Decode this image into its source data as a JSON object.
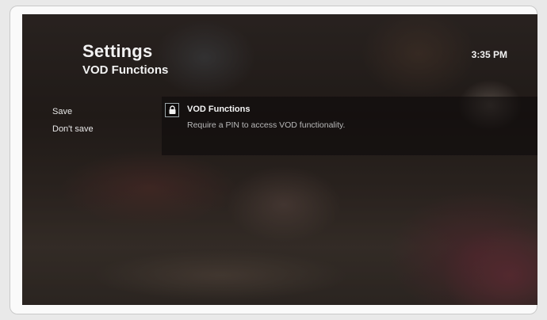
{
  "header": {
    "title": "Settings",
    "subtitle": "VOD Functions",
    "clock": "3:35 PM"
  },
  "menu": {
    "items": [
      {
        "label": "Save"
      },
      {
        "label": "Don't save"
      }
    ]
  },
  "panel": {
    "icon": "lock-icon",
    "title": "VOD Functions",
    "description": "Require a PIN to access VOD functionality."
  },
  "colors": {
    "text": "#f2f2f2",
    "muted": "#b9b9b9",
    "panel_bg": "#0f0c0c"
  }
}
